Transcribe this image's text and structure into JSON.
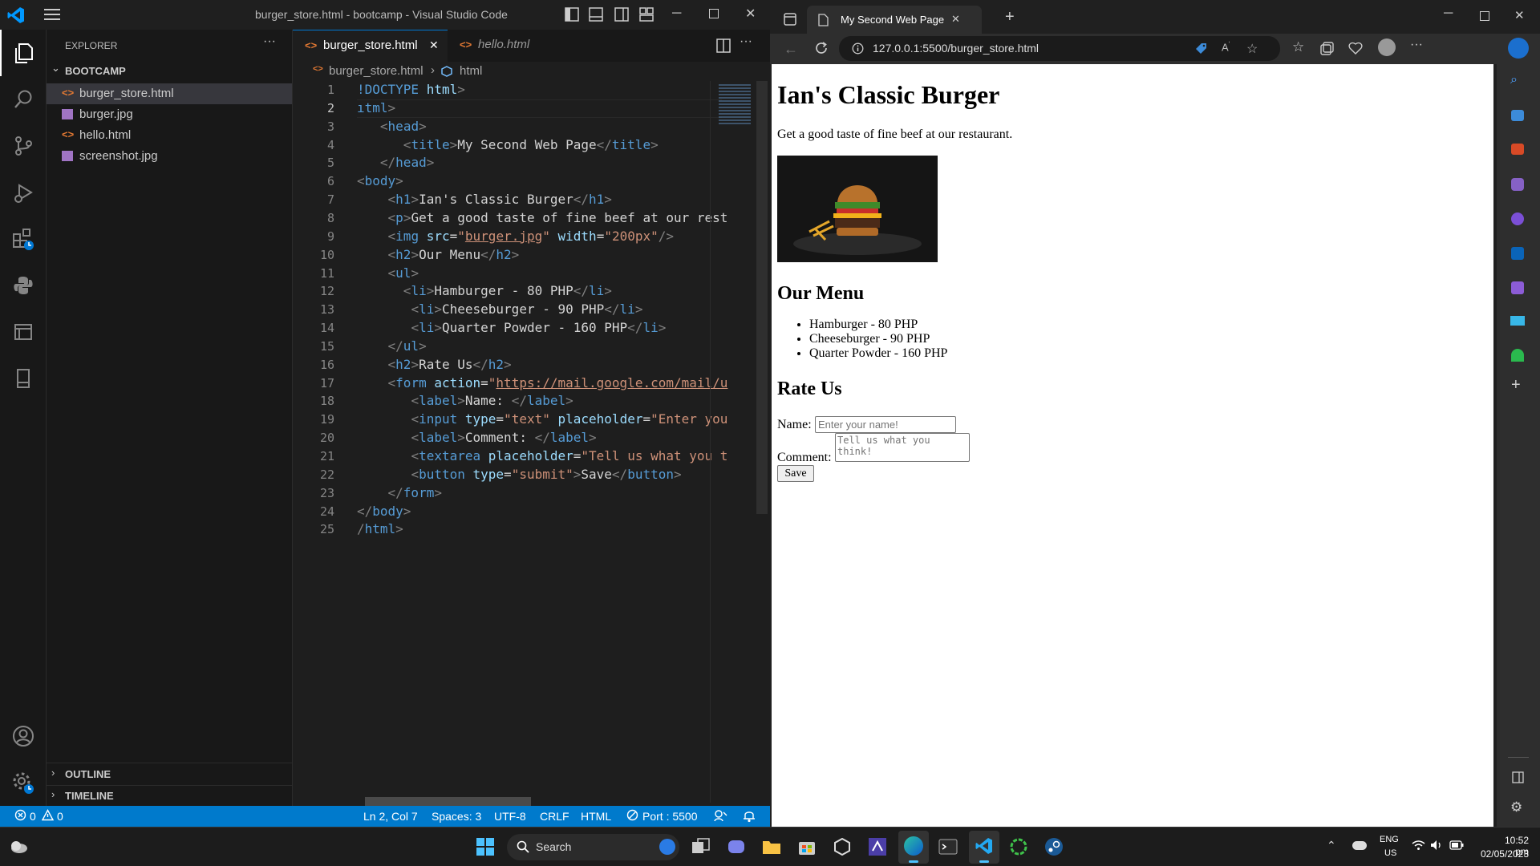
{
  "vscode": {
    "window_title": "burger_store.html - bootcamp - Visual Studio Code",
    "explorer_label": "EXPLORER",
    "folder_name": "BOOTCAMP",
    "files": [
      "burger_store.html",
      "burger.jpg",
      "hello.html",
      "screenshot.jpg"
    ],
    "outline_label": "OUTLINE",
    "timeline_label": "TIMELINE",
    "tabs": [
      {
        "label": "burger_store.html",
        "close": "✕"
      },
      {
        "label": "hello.html"
      }
    ],
    "breadcrumb": {
      "file": "burger_store.html",
      "node": "html"
    },
    "line_numbers": [
      "1",
      "2",
      "3",
      "4",
      "5",
      "6",
      "7",
      "8",
      "9",
      "10",
      "11",
      "12",
      "13",
      "14",
      "15",
      "16",
      "17",
      "18",
      "19",
      "20",
      "21",
      "22",
      "23",
      "24",
      "25"
    ],
    "status": {
      "errors": "0",
      "warnings": "0",
      "position": "Ln 2, Col 7",
      "spaces": "Spaces: 3",
      "encoding": "UTF-8",
      "eol": "CRLF",
      "language": "HTML",
      "port": "Port : 5500"
    }
  },
  "edge": {
    "tab_title": "My Second Web Page",
    "url": "127.0.0.1:5500/burger_store.html"
  },
  "page": {
    "h1": "Ian's Classic Burger",
    "intro": "Get a good taste of fine beef at our restaurant.",
    "menu_heading": "Our Menu",
    "menu_items": [
      "Hamburger - 80 PHP",
      "Cheeseburger - 90 PHP",
      "Quarter Powder - 160 PHP"
    ],
    "rate_heading": "Rate Us",
    "name_label": "Name:",
    "name_placeholder": "Enter your name!",
    "comment_label": "Comment:",
    "comment_placeholder": "Tell us what you think!",
    "save_label": "Save"
  },
  "taskbar": {
    "search_label": "Search",
    "lang": "ENG",
    "region": "US",
    "time": "10:52 pm",
    "date": "02/05/2023"
  },
  "colors": {
    "vscode_accent": "#007acc",
    "edge_bg": "#202020",
    "html_tag": "#569cd6",
    "attr": "#9cdcfe",
    "string": "#ce9178"
  }
}
